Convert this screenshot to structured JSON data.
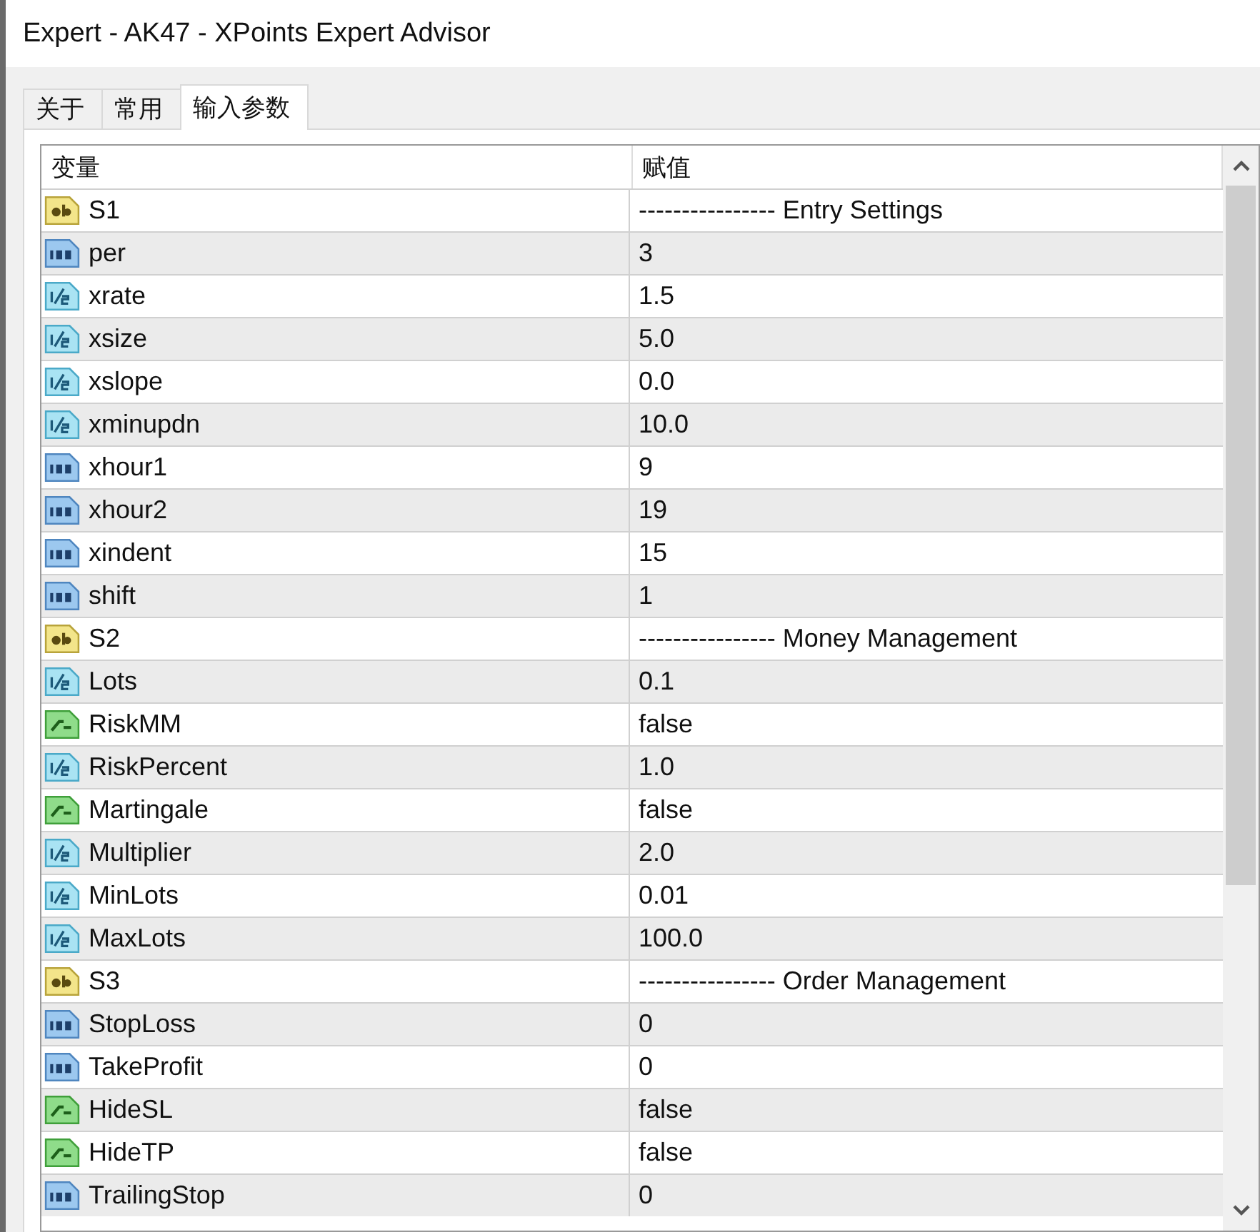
{
  "window": {
    "title": "Expert - AK47 - XPoints Expert Advisor"
  },
  "tabs": [
    {
      "label": "关于",
      "selected": false
    },
    {
      "label": "常用",
      "selected": false
    },
    {
      "label": "输入参数",
      "selected": true
    }
  ],
  "table": {
    "columns": [
      "变量",
      "赋值"
    ],
    "rows": [
      {
        "kind": "string",
        "name": "S1",
        "value": "---------------- Entry Settings"
      },
      {
        "kind": "int",
        "name": "per",
        "value": "3"
      },
      {
        "kind": "double",
        "name": "xrate",
        "value": "1.5"
      },
      {
        "kind": "double",
        "name": "xsize",
        "value": "5.0"
      },
      {
        "kind": "double",
        "name": "xslope",
        "value": "0.0"
      },
      {
        "kind": "double",
        "name": "xminupdn",
        "value": "10.0"
      },
      {
        "kind": "int",
        "name": "xhour1",
        "value": "9"
      },
      {
        "kind": "int",
        "name": "xhour2",
        "value": "19"
      },
      {
        "kind": "int",
        "name": "xindent",
        "value": "15"
      },
      {
        "kind": "int",
        "name": "shift",
        "value": "1"
      },
      {
        "kind": "string",
        "name": "S2",
        "value": "---------------- Money Management"
      },
      {
        "kind": "double",
        "name": "Lots",
        "value": "0.1"
      },
      {
        "kind": "bool",
        "name": "RiskMM",
        "value": "false"
      },
      {
        "kind": "double",
        "name": "RiskPercent",
        "value": "1.0"
      },
      {
        "kind": "bool",
        "name": "Martingale",
        "value": "false"
      },
      {
        "kind": "double",
        "name": "Multiplier",
        "value": "2.0"
      },
      {
        "kind": "double",
        "name": "MinLots",
        "value": "0.01"
      },
      {
        "kind": "double",
        "name": "MaxLots",
        "value": "100.0"
      },
      {
        "kind": "string",
        "name": "S3",
        "value": "---------------- Order Management"
      },
      {
        "kind": "int",
        "name": "StopLoss",
        "value": "0"
      },
      {
        "kind": "int",
        "name": "TakeProfit",
        "value": "0"
      },
      {
        "kind": "bool",
        "name": "HideSL",
        "value": "false"
      },
      {
        "kind": "bool",
        "name": "HideTP",
        "value": "false"
      },
      {
        "kind": "int",
        "name": "TrailingStop",
        "value": "0"
      }
    ]
  }
}
